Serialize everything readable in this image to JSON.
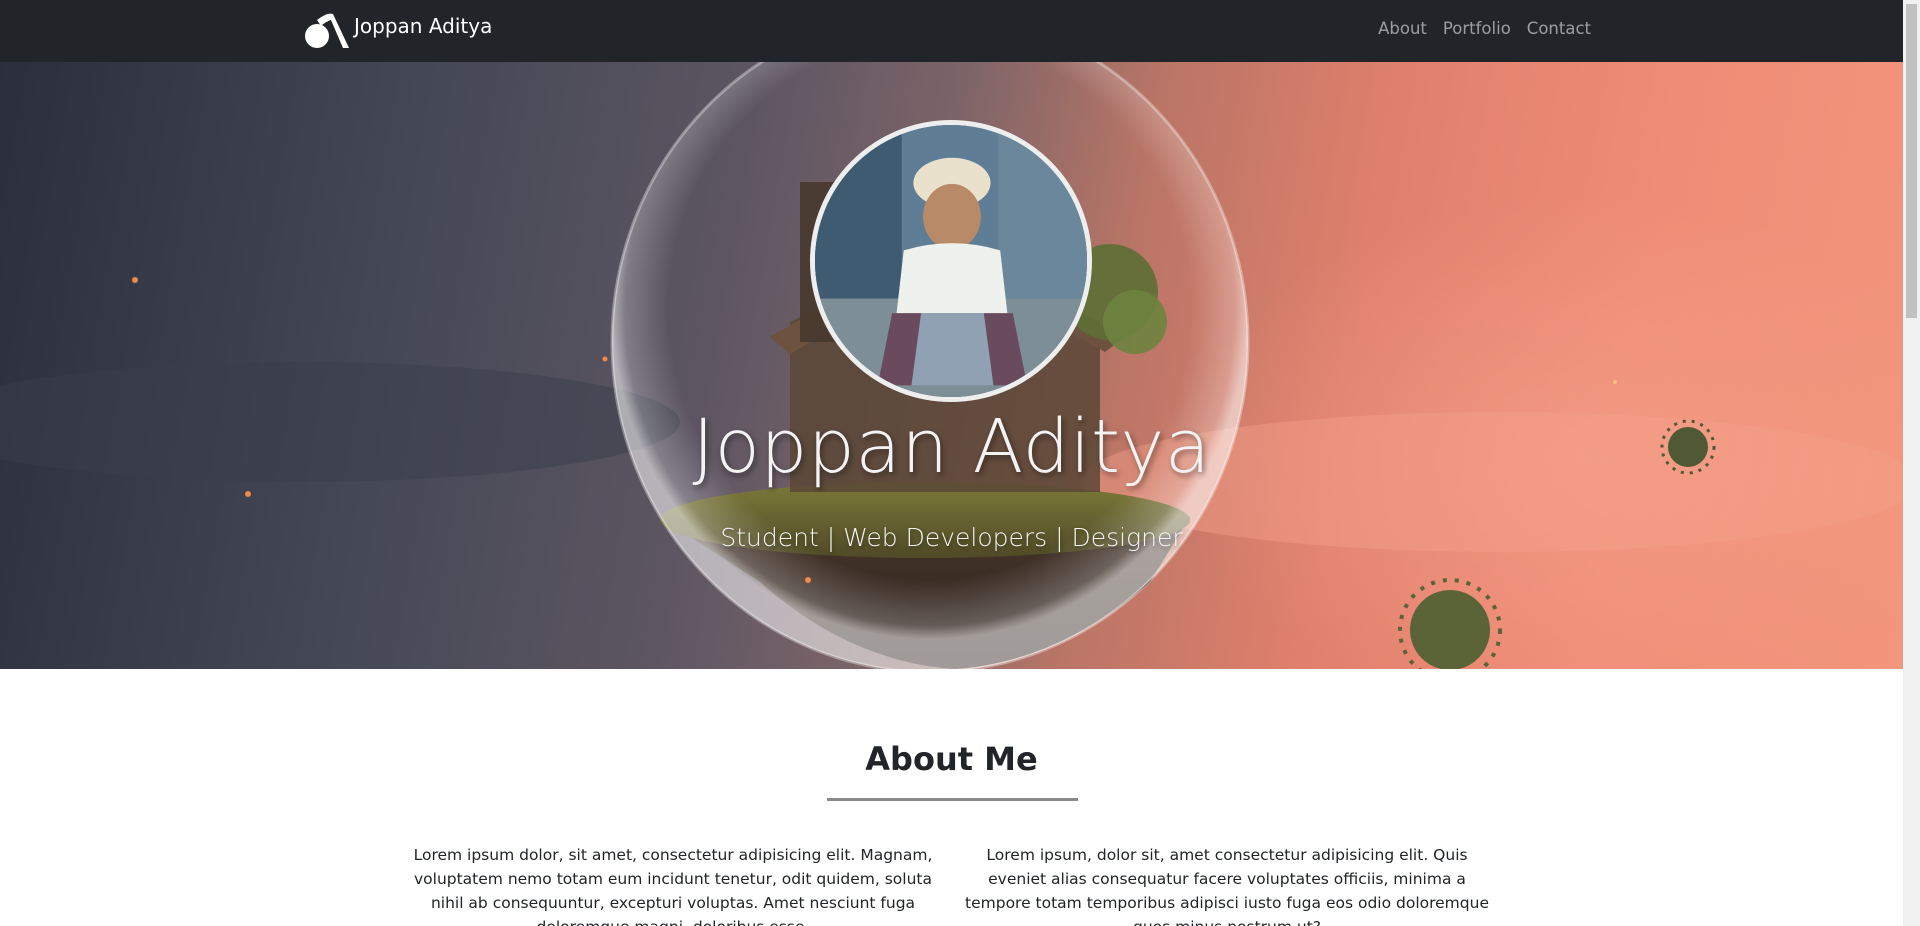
{
  "navbar": {
    "brand_name": "Joppan Aditya",
    "logo_icon": "JA-monogram-logo",
    "links": [
      {
        "label": "About"
      },
      {
        "label": "Portfolio"
      },
      {
        "label": "Contact"
      }
    ]
  },
  "hero": {
    "name": "Joppan Aditya",
    "tagline": "Student | Web Developers | Designer",
    "avatar_alt": "profile-photo"
  },
  "about": {
    "title": "About Me",
    "left_paragraph": "Lorem ipsum dolor, sit amet, consectetur adipisicing elit. Magnam, voluptatem nemo totam eum incidunt tenetur, odit quidem, soluta nihil ab consequuntur, excepturi voluptas. Amet nesciunt fuga doloremque magni, doloribus esse.",
    "right_paragraph": "Lorem ipsum, dolor sit, amet consectetur adipisicing elit. Quis eveniet alias consequatur facere voluptates officiis, minima a tempore totam temporibus adipisci iusto fuga eos odio doloremque quos minus nostrum ut?"
  },
  "colors": {
    "navbar_bg": "#212529",
    "nav_link": "#9a9da0",
    "hero_sky_left": "#2b2f3c",
    "hero_sky_right": "#f2967d",
    "divider": "#8a8a8a"
  }
}
